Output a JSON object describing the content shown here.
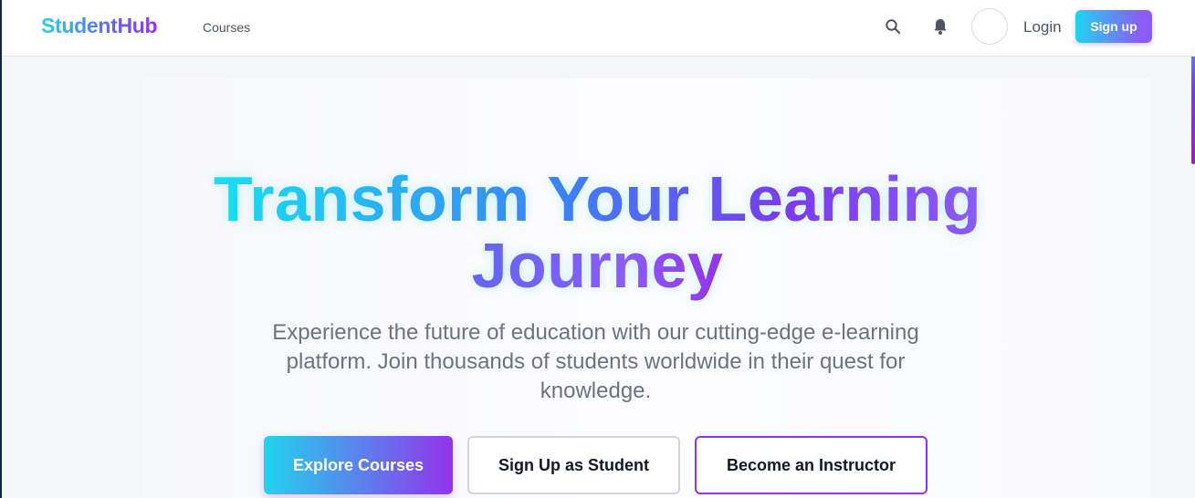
{
  "navbar": {
    "brand": "StudentHub",
    "links": [
      {
        "label": "Courses"
      }
    ],
    "icons": {
      "search": "search-icon",
      "notifications": "bell-icon"
    },
    "login_label": "Login",
    "signup_label": "Sign up"
  },
  "hero": {
    "title_line1": "Transform Your Learning",
    "title_line2": "Journey",
    "subtitle": "Experience the future of education with our cutting-edge e-learning platform. Join thousands of students worldwide in their quest for knowledge.",
    "buttons": {
      "explore": "Explore Courses",
      "student": "Sign Up as Student",
      "instructor": "Become an Instructor"
    }
  },
  "colors": {
    "gradient_start": "#22d3ee",
    "gradient_mid": "#6366f1",
    "gradient_end": "#9333ea",
    "instructor_border": "#9333ea"
  }
}
